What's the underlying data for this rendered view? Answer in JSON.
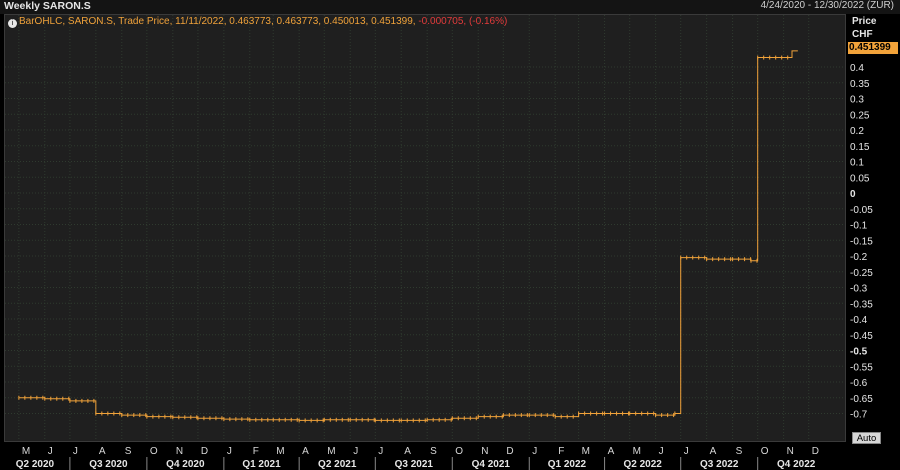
{
  "header": {
    "title": "Weekly SARON.S",
    "date_range": "4/24/2020 - 12/30/2022 (ZUR)"
  },
  "legend": {
    "text": "BarOHLC, SARON.S, Trade Price,  11/11/2022, 0.463773, 0.463773, 0.450013, 0.451399,",
    "change": "-0.000705, (-0.16%)"
  },
  "axis": {
    "ylabel_line1": "Price",
    "ylabel_line2": "CHF",
    "last_price": "0.451399",
    "auto_button": "Auto"
  },
  "colors": {
    "background": "#000000",
    "plot_bg": "#1f1f1f",
    "grid": "#2f3a2f",
    "series": "#f0a23a",
    "change_negative": "#e23b3b"
  },
  "chart_data": {
    "type": "line",
    "subtype": "OHLC bars",
    "title": "Weekly SARON.S",
    "ylabel": "Price CHF",
    "ylim": [
      -0.75,
      0.45
    ],
    "yticks": [
      "0.4",
      "0.35",
      "0.3",
      "0.25",
      "0.2",
      "0.15",
      "0.1",
      "0.05",
      "0",
      "-0.05",
      "-0.1",
      "-0.15",
      "-0.2",
      "-0.25",
      "-0.3",
      "-0.35",
      "-0.4",
      "-0.45",
      "-0.5",
      "-0.55",
      "-0.6",
      "-0.65",
      "-0.7"
    ],
    "month_ticks": [
      "M",
      "J",
      "J",
      "A",
      "S",
      "O",
      "N",
      "D",
      "J",
      "F",
      "M",
      "A",
      "M",
      "J",
      "J",
      "A",
      "S",
      "O",
      "N",
      "D",
      "J",
      "F",
      "M",
      "A",
      "M",
      "J",
      "J",
      "A",
      "S",
      "O",
      "N",
      "D"
    ],
    "quarter_ticks": [
      "Q2 2020",
      "Q3 2020",
      "Q4 2020",
      "Q1 2021",
      "Q2 2021",
      "Q3 2021",
      "Q4 2021",
      "Q1 2022",
      "Q2 2022",
      "Q3 2022",
      "Q4 2022"
    ],
    "series": [
      {
        "name": "SARON.S",
        "x": [
          "2020-05-01",
          "2020-06-01",
          "2020-07-01",
          "2020-08-01",
          "2020-09-01",
          "2020-10-01",
          "2020-11-01",
          "2020-12-01",
          "2021-01-01",
          "2021-02-01",
          "2021-03-01",
          "2021-04-01",
          "2021-05-01",
          "2021-06-01",
          "2021-07-01",
          "2021-08-01",
          "2021-09-01",
          "2021-10-01",
          "2021-11-01",
          "2021-12-01",
          "2022-01-01",
          "2022-02-01",
          "2022-03-01",
          "2022-04-01",
          "2022-05-01",
          "2022-06-01",
          "2022-06-24",
          "2022-07-01",
          "2022-08-01",
          "2022-09-01",
          "2022-09-23",
          "2022-10-01",
          "2022-11-11"
        ],
        "values": [
          -0.65,
          -0.653,
          -0.66,
          -0.7,
          -0.705,
          -0.71,
          -0.712,
          -0.715,
          -0.718,
          -0.72,
          -0.72,
          -0.722,
          -0.72,
          -0.72,
          -0.722,
          -0.722,
          -0.72,
          -0.715,
          -0.71,
          -0.705,
          -0.705,
          -0.71,
          -0.7,
          -0.7,
          -0.7,
          -0.705,
          -0.7,
          -0.205,
          -0.21,
          -0.21,
          -0.215,
          0.43,
          0.451
        ]
      }
    ]
  }
}
